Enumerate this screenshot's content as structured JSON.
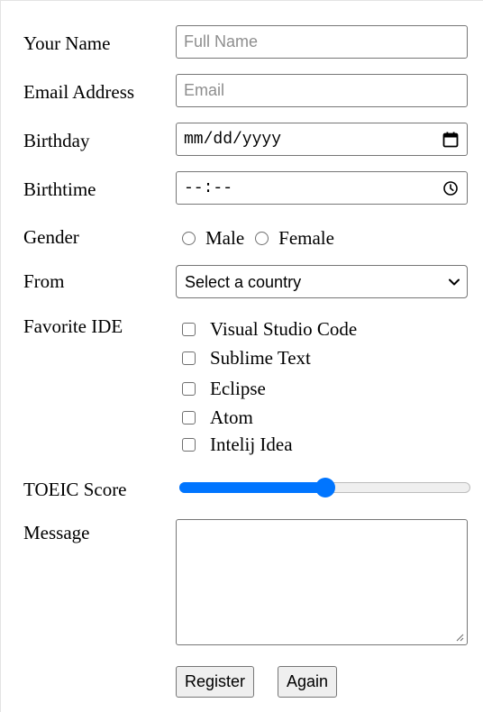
{
  "form": {
    "name": {
      "label": "Your Name",
      "placeholder": "Full Name",
      "value": ""
    },
    "email": {
      "label": "Email Address",
      "placeholder": "Email",
      "value": ""
    },
    "birthday": {
      "label": "Birthday",
      "display": "mm/dd/yyyy",
      "icon": "calendar-icon"
    },
    "birthtime": {
      "label": "Birthtime",
      "display": "--:--",
      "icon": "clock-icon"
    },
    "gender": {
      "label": "Gender",
      "options": [
        "Male",
        "Female"
      ],
      "selected": null
    },
    "from": {
      "label": "From",
      "selected": "Select a country",
      "icon": "chevron-down-icon"
    },
    "ide": {
      "label": "Favorite IDE",
      "options": [
        "Visual Studio Code",
        "Sublime Text",
        "Eclipse",
        "Atom",
        "Intelij Idea"
      ],
      "checked": []
    },
    "toeic": {
      "label": "TOEIC Score",
      "fraction": 0.5
    },
    "message": {
      "label": "Message",
      "value": ""
    },
    "buttons": {
      "register": "Register",
      "again": "Again"
    }
  },
  "colors": {
    "accent": "#0075ff",
    "border": "#767676",
    "button_bg": "#efefef",
    "placeholder": "#8e8e8e"
  }
}
